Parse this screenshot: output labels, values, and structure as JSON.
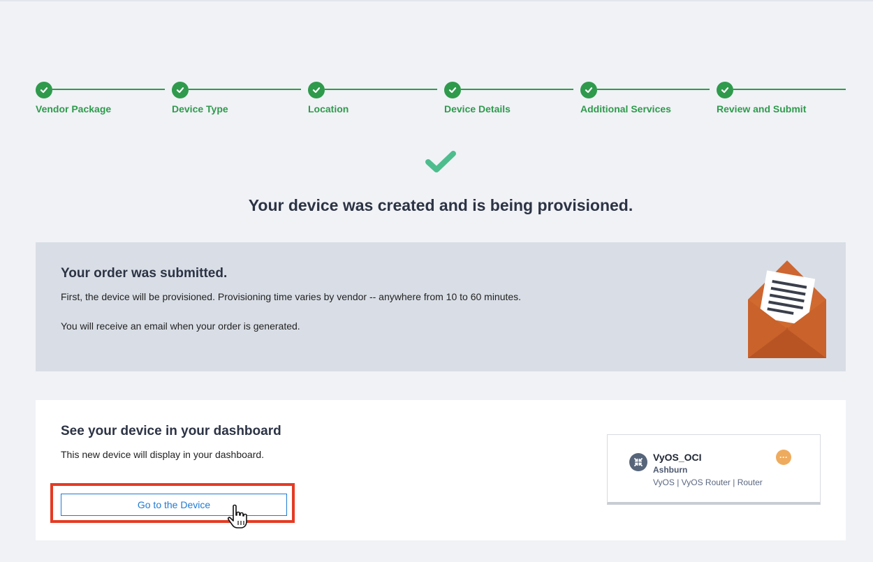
{
  "steps": [
    {
      "label": "Vendor Package"
    },
    {
      "label": "Device Type"
    },
    {
      "label": "Location"
    },
    {
      "label": "Device Details"
    },
    {
      "label": "Additional Services"
    },
    {
      "label": "Review and Submit"
    }
  ],
  "success": {
    "headline": "Your device was created and is being provisioned."
  },
  "order": {
    "title": "Your order was submitted.",
    "line1": "First, the device will be provisioned. Provisioning time varies by vendor -- anywhere from 10 to 60 minutes.",
    "line2": "You will receive an email when your order is generated."
  },
  "dashboard": {
    "title": "See your device in your dashboard",
    "text": "This new device will display in your dashboard.",
    "button_label": "Go to the Device"
  },
  "device": {
    "name": "VyOS_OCI",
    "location": "Ashburn",
    "description": "VyOS | VyOS Router | Router",
    "menu_label": "···"
  },
  "colors": {
    "step_green": "#2f9a4c",
    "success_check": "#4dbd8e",
    "link_blue": "#1f7ad4",
    "highlight_red": "#e53b24",
    "envelope_orange": "#d06a2e",
    "menu_orange": "#eeab5e"
  },
  "icons": {
    "step": "check-icon",
    "success": "checkmark-icon",
    "envelope": "envelope-letter-icon",
    "device": "router-icon",
    "menu": "more-icon",
    "cursor": "hand-pointer-icon"
  }
}
